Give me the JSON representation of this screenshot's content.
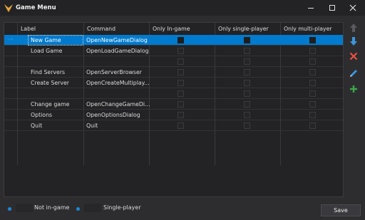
{
  "window": {
    "title": "Game Menu"
  },
  "columns": [
    "Label",
    "Command",
    "Only In-game",
    "Only single-player",
    "Only multi-player"
  ],
  "rows": [
    {
      "label": "New Game",
      "command": "OpenNewGameDialog",
      "selected": true
    },
    {
      "label": "Load Game",
      "command": "OpenLoadGameDialog",
      "selected": false
    },
    {
      "label": "",
      "command": "",
      "selected": false
    },
    {
      "label": "Find Servers",
      "command": "OpenServerBrowser",
      "selected": false
    },
    {
      "label": "Create Server",
      "command": "OpenCreateMultiplay...",
      "selected": false
    },
    {
      "label": "",
      "command": "",
      "selected": false
    },
    {
      "label": "Change game",
      "command": "OpenChangeGameDi...",
      "selected": false
    },
    {
      "label": "Options",
      "command": "OpenOptionsDialog",
      "selected": false
    },
    {
      "label": "Quit",
      "command": "Quit",
      "selected": false
    }
  ],
  "footer": {
    "legend_not_ingame": "Not in-game",
    "legend_singleplayer": "Single-player",
    "save_label": "Save"
  },
  "colors": {
    "accent": "#007acc",
    "background": "#2d2d30"
  }
}
